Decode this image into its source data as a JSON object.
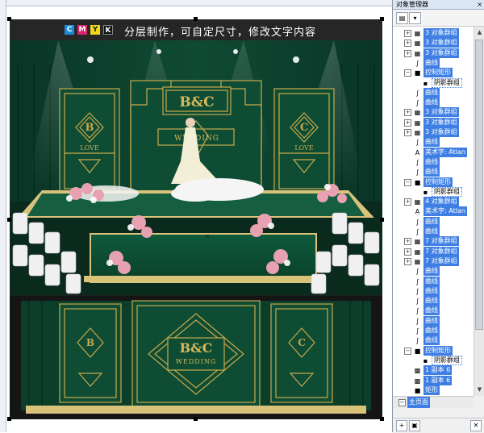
{
  "banner": {
    "text": "分层制作，可自定尺寸，修改文字内容",
    "cmyk": [
      {
        "letter": "C",
        "color": "#1e8bd6"
      },
      {
        "letter": "M",
        "color": "#d6246e"
      },
      {
        "letter": "Y",
        "color": "#f2d81a"
      },
      {
        "letter": "K",
        "color": "#111111"
      }
    ]
  },
  "stage": {
    "monogram": "B&C",
    "wedding_text": "WEDDING",
    "left_initial": "B",
    "right_initial": "C",
    "love_text": "LOVE",
    "colors": {
      "green": "#0e4d34",
      "gold": "#c9a84c",
      "curtain": "#0b3f2a",
      "floor": "#0f5a3c"
    }
  },
  "canvas": {
    "crosshair_symbol": "×"
  },
  "panel": {
    "title": "对象管理器",
    "close_glyph": "×",
    "toolbar_icons": [
      "layers-icon",
      "options-icon"
    ],
    "tree": [
      {
        "indent": 1,
        "icon": "group-icon",
        "label": "3 对象群组",
        "selected": true,
        "expander": "+"
      },
      {
        "indent": 1,
        "icon": "group-icon",
        "label": "3 对象群组",
        "selected": true,
        "expander": "+"
      },
      {
        "indent": 1,
        "icon": "group-icon",
        "label": "3 对象群组",
        "selected": true,
        "expander": "+"
      },
      {
        "indent": 1,
        "icon": "curve-icon",
        "label": "曲线",
        "selected": true,
        "expander": ""
      },
      {
        "indent": 1,
        "icon": "rect-icon",
        "label": "控制矩形",
        "selected": true,
        "expander": "−"
      },
      {
        "indent": 2,
        "icon": "shadow-icon",
        "label": "阴影群组",
        "selected": false,
        "outlined": true,
        "expander": ""
      },
      {
        "indent": 1,
        "icon": "curve-icon",
        "label": "曲线",
        "selected": true,
        "expander": ""
      },
      {
        "indent": 1,
        "icon": "curve-icon",
        "label": "曲线",
        "selected": true,
        "expander": ""
      },
      {
        "indent": 1,
        "icon": "group-icon",
        "label": "3 对象群组",
        "selected": true,
        "expander": "+"
      },
      {
        "indent": 1,
        "icon": "group-icon",
        "label": "3 对象群组",
        "selected": true,
        "expander": "+"
      },
      {
        "indent": 1,
        "icon": "group-icon",
        "label": "3 对象群组",
        "selected": true,
        "expander": "+"
      },
      {
        "indent": 1,
        "icon": "curve-icon",
        "label": "曲线",
        "selected": true,
        "expander": ""
      },
      {
        "indent": 1,
        "icon": "text-icon",
        "label": "美术字: Atlan",
        "selected": true,
        "expander": ""
      },
      {
        "indent": 1,
        "icon": "curve-icon",
        "label": "曲线",
        "selected": true,
        "expander": ""
      },
      {
        "indent": 1,
        "icon": "curve-icon",
        "label": "曲线",
        "selected": true,
        "expander": ""
      },
      {
        "indent": 1,
        "icon": "rect-icon",
        "label": "控制矩形",
        "selected": true,
        "expander": "−"
      },
      {
        "indent": 2,
        "icon": "shadow-icon",
        "label": "阴影群组",
        "selected": false,
        "outlined": true,
        "expander": ""
      },
      {
        "indent": 1,
        "icon": "group-icon",
        "label": "4 对象群组",
        "selected": true,
        "expander": "+"
      },
      {
        "indent": 1,
        "icon": "text-icon",
        "label": "美术字: Atlan",
        "selected": true,
        "expander": ""
      },
      {
        "indent": 1,
        "icon": "curve-icon",
        "label": "曲线",
        "selected": true,
        "expander": ""
      },
      {
        "indent": 1,
        "icon": "curve-icon",
        "label": "曲线",
        "selected": true,
        "expander": ""
      },
      {
        "indent": 1,
        "icon": "group-icon",
        "label": "7 对象群组",
        "selected": true,
        "expander": "+"
      },
      {
        "indent": 1,
        "icon": "group-icon",
        "label": "7 对象群组",
        "selected": true,
        "expander": "+"
      },
      {
        "indent": 1,
        "icon": "group-icon",
        "label": "7 对象群组",
        "selected": true,
        "expander": "+"
      },
      {
        "indent": 1,
        "icon": "curve-icon",
        "label": "曲线",
        "selected": true,
        "expander": ""
      },
      {
        "indent": 1,
        "icon": "curve-icon",
        "label": "曲线",
        "selected": true,
        "expander": ""
      },
      {
        "indent": 1,
        "icon": "curve-icon",
        "label": "曲线",
        "selected": true,
        "expander": ""
      },
      {
        "indent": 1,
        "icon": "curve-icon",
        "label": "曲线",
        "selected": true,
        "expander": ""
      },
      {
        "indent": 1,
        "icon": "curve-icon",
        "label": "曲线",
        "selected": true,
        "expander": ""
      },
      {
        "indent": 1,
        "icon": "curve-icon",
        "label": "曲线",
        "selected": true,
        "expander": ""
      },
      {
        "indent": 1,
        "icon": "curve-icon",
        "label": "曲线",
        "selected": true,
        "expander": ""
      },
      {
        "indent": 1,
        "icon": "curve-icon",
        "label": "曲线",
        "selected": true,
        "expander": ""
      },
      {
        "indent": 1,
        "icon": "rect-icon",
        "label": "控制矩形",
        "selected": true,
        "expander": "−"
      },
      {
        "indent": 2,
        "icon": "shadow-icon",
        "label": "阴影群组",
        "selected": false,
        "outlined": true,
        "expander": ""
      },
      {
        "indent": 1,
        "icon": "bitmap-icon",
        "label": "1 副本 6",
        "selected": true,
        "expander": ""
      },
      {
        "indent": 1,
        "icon": "bitmap-icon",
        "label": "1 副本 6",
        "selected": true,
        "expander": ""
      },
      {
        "indent": 1,
        "icon": "rect-icon",
        "label": "矩形",
        "selected": true,
        "expander": ""
      }
    ],
    "page_label": "主页面",
    "bottom_icons": [
      "new-layer-icon",
      "new-master-layer-icon",
      "delete-icon"
    ]
  }
}
